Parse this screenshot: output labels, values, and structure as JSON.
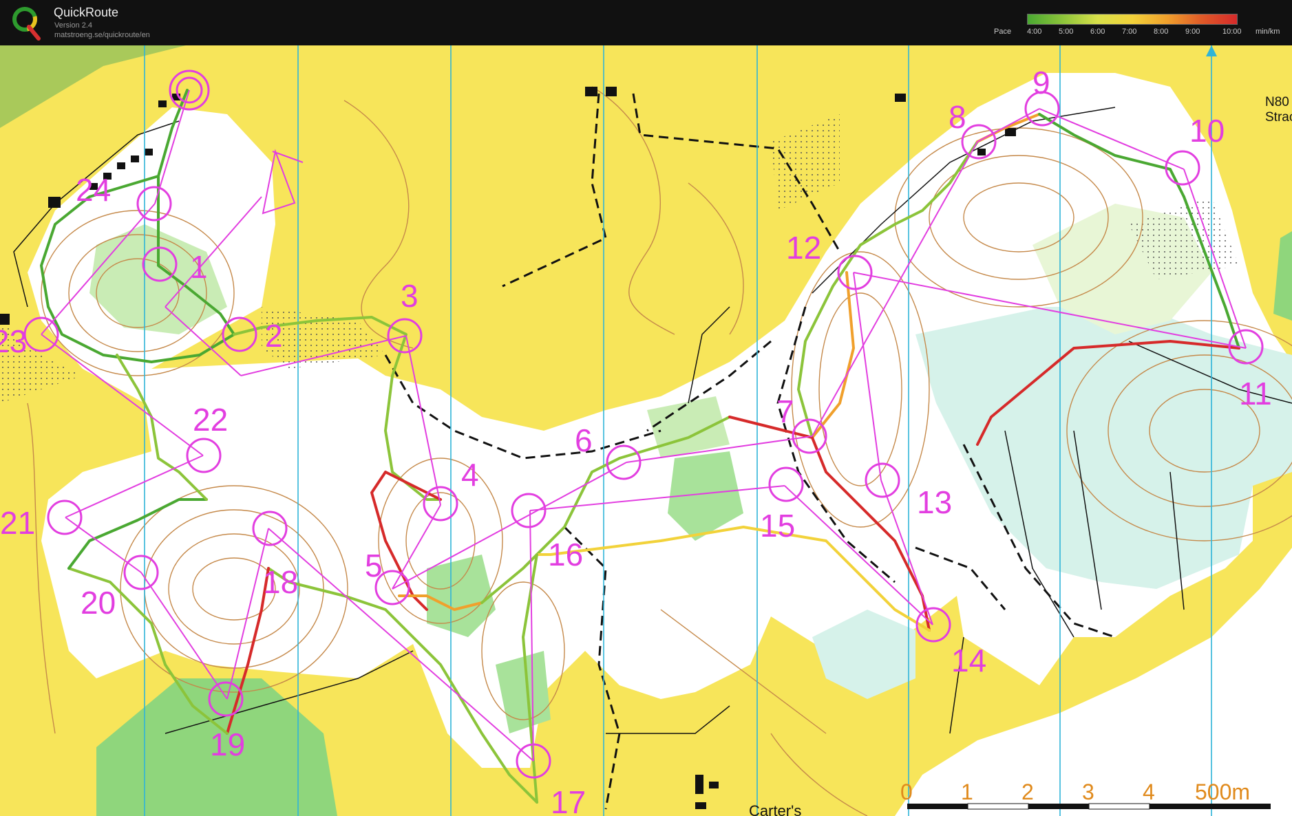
{
  "app": {
    "title": "QuickRoute",
    "version": "Version 2.4",
    "url": "matstroeng.se/quickroute/en"
  },
  "pace_legend": {
    "label": "Pace",
    "ticks": [
      "4:00",
      "5:00",
      "6:00",
      "7:00",
      "8:00",
      "9:00",
      "10:00"
    ],
    "unit": "min/km",
    "colors": [
      "#4aa832",
      "#8cc43a",
      "#d8e04a",
      "#f2d23a",
      "#f0a02c",
      "#e05a28",
      "#d62a2a"
    ]
  },
  "map": {
    "colors": {
      "open": "#f7e55a",
      "rough": "#fbf4b0",
      "forest": "#ffffff",
      "green": "#8fd67c",
      "light_green": "#c9ecb5",
      "marsh": "#d6f2ea",
      "magenta": "#e23ee0",
      "contour": "#c5894a",
      "grid": "#2fb4d8"
    },
    "controls": [
      "1",
      "2",
      "3",
      "4",
      "5",
      "6",
      "7",
      "8",
      "9",
      "10",
      "11",
      "12",
      "13",
      "14",
      "15",
      "16",
      "17",
      "18",
      "19",
      "20",
      "21",
      "22",
      "23",
      "24"
    ],
    "labels": {
      "road_n80": "N80",
      "road_strac": "Strac",
      "place_carters": "Carter's"
    },
    "scale": {
      "ticks": [
        "0",
        "1",
        "2",
        "3",
        "4"
      ],
      "end_label": "500m"
    }
  }
}
